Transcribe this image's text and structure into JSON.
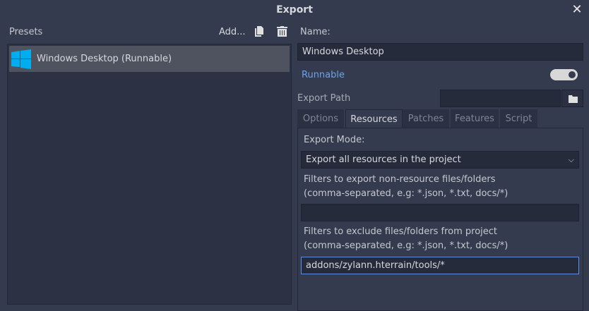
{
  "dialog": {
    "title": "Export",
    "close_icon": "close-icon"
  },
  "presets": {
    "label": "Presets",
    "add_label": "Add...",
    "duplicate_icon": "duplicate-icon",
    "delete_icon": "trash-icon",
    "items": [
      {
        "label": "Windows Desktop (Runnable)",
        "icon": "windows-logo-icon",
        "selected": true
      }
    ]
  },
  "details": {
    "name_label": "Name:",
    "name_value": "Windows Desktop",
    "runnable_label": "Runnable",
    "runnable_on": true,
    "export_path_label": "Export Path",
    "export_path_value": "",
    "folder_icon": "folder-icon",
    "tabs": [
      {
        "label": "Options"
      },
      {
        "label": "Resources",
        "active": true
      },
      {
        "label": "Patches"
      },
      {
        "label": "Features"
      },
      {
        "label": "Script"
      }
    ],
    "resources": {
      "export_mode_label": "Export Mode:",
      "export_mode_value": "Export all resources in the project",
      "include_label_1": "Filters to export non-resource files/folders",
      "include_label_2": "(comma-separated, e.g: *.json, *.txt, docs/*)",
      "include_value": "",
      "exclude_label_1": "Filters to exclude files/folders from project",
      "exclude_label_2": "(comma-separated, e.g: *.json, *.txt, docs/*)",
      "exclude_value": "addons/zylann.hterrain/tools/*"
    }
  },
  "colors": {
    "accent": "#5d8fd9",
    "runnable": "#6ea2e8",
    "windows_logo": "#00adef"
  }
}
